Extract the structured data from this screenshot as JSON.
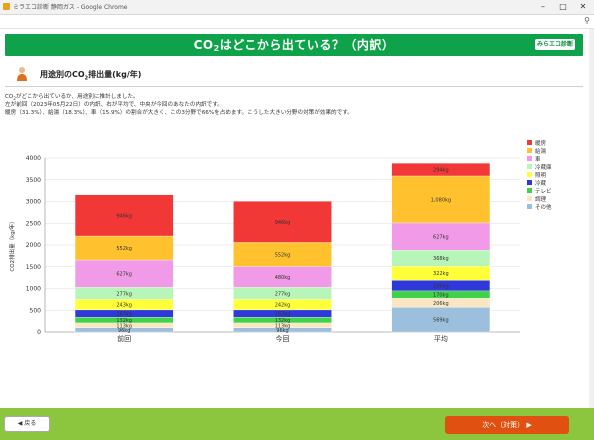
{
  "browser": {
    "window_title": "ミラエコ診断 静岡ガス - Google Chrome",
    "minimize": "–",
    "maximize": "□",
    "close": "✕",
    "zoom_icon": "magnifier-icon"
  },
  "banner": {
    "title_pre": "CO",
    "title_sub": "2",
    "title_post": "はどこから出ている？（内訳）",
    "logo": "みらエコ診断"
  },
  "section": {
    "title_pre": "用途別のCO",
    "title_sub": "2",
    "title_post": "排出量(kg/年)"
  },
  "description": {
    "line1_pre": "CO",
    "line1_sub": "2",
    "line1_post": "がどこから出ているか、用途別に推計しました。",
    "line2": "左が前回（2023年05月22日）の内訳、右が平均で、中央が今回のあなたの内訳です。",
    "line3": "暖房（31.3%）、給湯（18.3%）、車（15.9%）の割合が大きく、この3分野で66%を占めます。こうした大きい分野の対策が効果的です。"
  },
  "chart_data": {
    "type": "bar",
    "stacked": true,
    "categories": [
      "前回",
      "今回",
      "平均"
    ],
    "ylabel": "CO2排出量（kg/年）",
    "ylim": [
      0,
      4000
    ],
    "yticks": [
      0,
      500,
      1000,
      1500,
      2000,
      2500,
      3000,
      3500,
      4000
    ],
    "grid": true,
    "legend_position": "right",
    "series": [
      {
        "name": "その他",
        "color": "#9bbfdc",
        "values": [
          96,
          96,
          569
        ],
        "labels": [
          "96kg",
          "96kg",
          "569kg"
        ]
      },
      {
        "name": "調理",
        "color": "#fbe6c2",
        "values": [
          113,
          113,
          206
        ],
        "labels": [
          "113kg",
          "113kg",
          "206kg"
        ]
      },
      {
        "name": "テレビ",
        "color": "#3fd24a",
        "values": [
          132,
          132,
          170
        ],
        "labels": [
          "132kg",
          "132kg",
          "170kg"
        ]
      },
      {
        "name": "冷蔵",
        "color": "#2f38d8",
        "values": [
          167,
          167,
          245
        ],
        "labels": [
          "167kg",
          "167kg",
          "245kg"
        ]
      },
      {
        "name": "照明",
        "color": "#ffff3a",
        "values": [
          243,
          242,
          322
        ],
        "labels": [
          "243kg",
          "242kg",
          "322kg"
        ]
      },
      {
        "name": "冷蔵庫",
        "color": "#b8f5b8",
        "values": [
          277,
          277,
          368
        ],
        "labels": [
          "277kg",
          "277kg",
          "368kg"
        ]
      },
      {
        "name": "車",
        "color": "#f09ae8",
        "values": [
          627,
          480,
          627
        ],
        "labels": [
          "627kg",
          "480kg",
          "627kg"
        ]
      },
      {
        "name": "給湯",
        "color": "#ffc22e",
        "values": [
          552,
          552,
          1080
        ],
        "labels": [
          "552kg",
          "552kg",
          "1,080kg"
        ]
      },
      {
        "name": "暖房",
        "color": "#f23737",
        "values": [
          946,
          946,
          294
        ],
        "labels": [
          "946kg",
          "946kg",
          "294kg"
        ]
      }
    ],
    "legend_order": [
      "暖房",
      "給湯",
      "車",
      "冷蔵庫",
      "照明",
      "冷蔵",
      "テレビ",
      "調理",
      "その他"
    ]
  },
  "footer": {
    "back_label": "◀ 戻る",
    "next_label": "次へ（対策） ▶"
  },
  "colors": {
    "banner": "#0ea34a",
    "footer": "#8cc63e",
    "next_button": "#e05010"
  }
}
